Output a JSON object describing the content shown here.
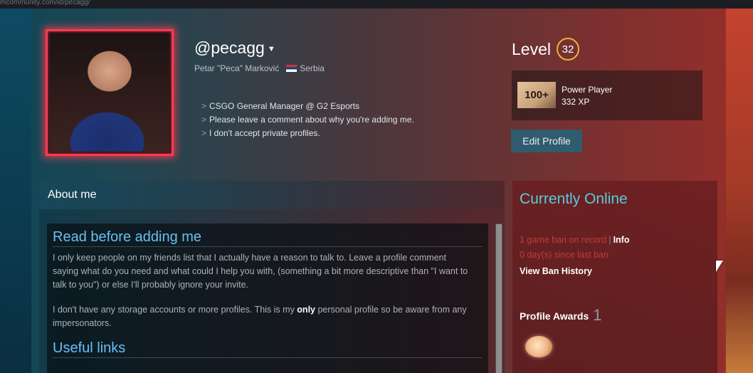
{
  "browser": {
    "url": "mcommunity.com/id/pecagg/"
  },
  "profile": {
    "username": "@pecagg",
    "real_name": "Petar \"Peca\" Marković",
    "country": "Serbia",
    "summary": [
      "CSGO General Manager @ G2 Esports",
      "Please leave a comment about why you're adding me.",
      "I don't accept private profiles."
    ],
    "bullet": ">"
  },
  "level": {
    "label": "Level",
    "value": "32"
  },
  "badge": {
    "icon_text": "100+",
    "name": "Power Player",
    "xp": "332 XP"
  },
  "edit_profile": "Edit Profile",
  "about": {
    "header": "About me",
    "heading1": "Read before adding me",
    "para1": "I only keep people on my friends list that I actually have a reason to talk to. Leave a profile comment saying what do you need and what could I help you with, (something a bit more descriptive than \"I want to talk to you\") or else I'll probably ignore your invite.",
    "para2_pre": "I don't have any storage accounts or more profiles. This is my ",
    "para2_bold": "only",
    "para2_post": " personal profile so be aware from any impersonators.",
    "heading2": "Useful links"
  },
  "status": {
    "online": "Currently Online",
    "ban_record": "1 game ban on record",
    "ban_sep": "|",
    "ban_info": "Info",
    "ban_days": "0 day(s) since last ban",
    "ban_history": "View Ban History",
    "awards_label": "Profile Awards",
    "awards_count": "1"
  },
  "icons": {
    "caret": "caret-down-icon",
    "flag": "serbia-flag-icon",
    "award": "award-icon",
    "cursor": "mouse-cursor-icon"
  },
  "colors": {
    "accent_blue": "#66c0f4",
    "online": "#57cbde",
    "ban_red": "#c23b3b",
    "level_ring": "#e6b43a",
    "avatar_frame": "#ff3b4d"
  }
}
